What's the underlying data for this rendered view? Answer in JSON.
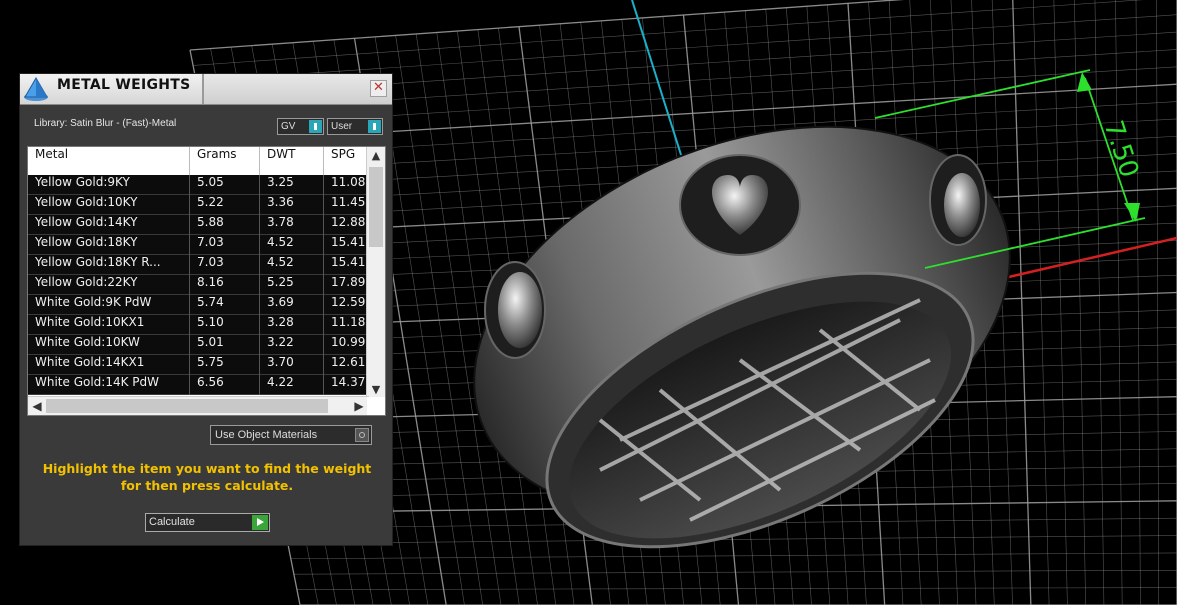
{
  "panel": {
    "title": "METAL WEIGHTS",
    "close_glyph": "✕",
    "library_label": "Library: Satin Blur - (Fast)-Metal",
    "toggle_gv": "GV",
    "toggle_user": "User",
    "columns": [
      "Metal",
      "Grams",
      "DWT",
      "SPG"
    ],
    "rows": [
      [
        "Yellow Gold:9KY",
        "5.05",
        "3.25",
        "11.08"
      ],
      [
        "Yellow Gold:10KY",
        "5.22",
        "3.36",
        "11.45"
      ],
      [
        "Yellow Gold:14KY",
        "5.88",
        "3.78",
        "12.88"
      ],
      [
        "Yellow Gold:18KY",
        "7.03",
        "4.52",
        "15.41"
      ],
      [
        "Yellow Gold:18KY R...",
        "7.03",
        "4.52",
        "15.41"
      ],
      [
        "Yellow Gold:22KY",
        "8.16",
        "5.25",
        "17.89"
      ],
      [
        "White Gold:9K PdW",
        "5.74",
        "3.69",
        "12.59"
      ],
      [
        "White Gold:10KX1",
        "5.10",
        "3.28",
        "11.18"
      ],
      [
        "White Gold:10KW",
        "5.01",
        "3.22",
        "10.99"
      ],
      [
        "White Gold:14KX1",
        "5.75",
        "3.70",
        "12.61"
      ],
      [
        "White Gold:14K PdW",
        "6.56",
        "4.22",
        "14.37"
      ]
    ],
    "use_object_materials": "Use Object Materials",
    "hint": "Highlight the item you want to find the weight for then press calculate.",
    "calculate_label": "Calculate",
    "icons": {
      "app": "pyramid-icon",
      "close": "close-icon",
      "scroll_up": "chevron-up-icon",
      "scroll_down": "chevron-down-icon",
      "scroll_left": "chevron-left-icon",
      "scroll_right": "chevron-right-icon"
    }
  },
  "viewport": {
    "dimension_label": "7.50",
    "colors": {
      "background": "#000000",
      "grid": "#9a9a9a",
      "axis_x": "#d42020",
      "axis_y": "#1ab0c8",
      "dimension": "#2ee02e",
      "hint_text": "#f2c200"
    }
  }
}
